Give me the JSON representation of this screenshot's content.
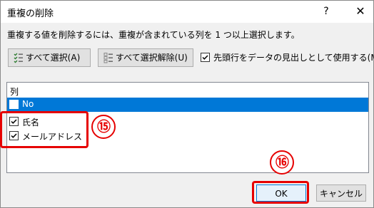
{
  "dialog": {
    "title": "重複の削除",
    "help_glyph": "?",
    "close_glyph": "✕",
    "instruction": "重複する値を削除するには、重複が含まれている列を 1 つ以上選択します。"
  },
  "toolbar": {
    "select_all_label": "すべて選択(A)",
    "unselect_all_label": "すべて選択解除(U)",
    "header_checkbox_label": "先頭行をデータの見出しとして使用する(M)",
    "header_checkbox_checked": true
  },
  "columns": {
    "header": "列",
    "items": [
      {
        "label": "No",
        "checked": false,
        "selected": true
      },
      {
        "label": "氏名",
        "checked": true,
        "selected": false
      },
      {
        "label": "メールアドレス",
        "checked": true,
        "selected": false
      }
    ]
  },
  "annotations": {
    "step_a": "⑮",
    "step_b": "⑯",
    "highlight_color": "#e60000"
  },
  "footer": {
    "ok_label": "OK",
    "cancel_label": "キャンセル"
  },
  "colors": {
    "selection": "#0078d7",
    "dialog_bg": "#f0f0f0"
  },
  "icons": {
    "select_all": "checklist-icon",
    "unselect_all": "unchecklist-icon"
  }
}
